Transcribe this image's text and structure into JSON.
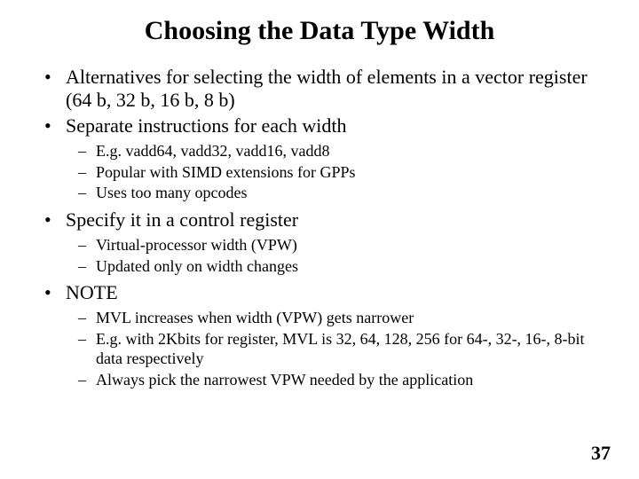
{
  "title": "Choosing the Data Type Width",
  "bullets": [
    {
      "text": "Alternatives for selecting the width of elements in a vector register (64 b, 32 b, 16 b, 8 b)",
      "sub": []
    },
    {
      "text": "Separate instructions for each width",
      "sub": [
        "E.g. vadd64, vadd32, vadd16, vadd8",
        "Popular with SIMD extensions for GPPs",
        "Uses too many opcodes"
      ]
    },
    {
      "text": "Specify it in a control register",
      "sub": [
        "Virtual-processor width (VPW)",
        "Updated only on width changes"
      ]
    },
    {
      "text": "NOTE",
      "sub": [
        "MVL increases when width (VPW) gets narrower",
        "E.g. with 2Kbits for register, MVL is 32, 64, 128, 256 for 64-, 32-, 16-, 8-bit data respectively",
        "Always pick the narrowest VPW needed by the application"
      ]
    }
  ],
  "page_number": "37"
}
